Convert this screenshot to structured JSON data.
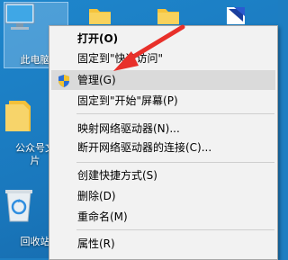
{
  "desktop": {
    "icons": [
      {
        "label_lines": [
          "此电脑"
        ]
      },
      {
        "label_lines": [
          "公众号文",
          "片"
        ]
      },
      {
        "label_lines": [
          "回收站"
        ]
      }
    ]
  },
  "context_menu": {
    "items": [
      {
        "label": "打开(O)"
      },
      {
        "label": "固定到\"快速访问\""
      },
      {
        "label": "管理(G)",
        "icon": "uac-shield-icon"
      },
      {
        "label": "固定到\"开始\"屏幕(P)"
      },
      {
        "label": "映射网络驱动器(N)..."
      },
      {
        "label": "断开网络驱动器的连接(C)..."
      },
      {
        "label": "创建快捷方式(S)"
      },
      {
        "label": "删除(D)"
      },
      {
        "label": "重命名(M)"
      },
      {
        "label": "属性(R)"
      }
    ]
  },
  "colors": {
    "desktop_bg": "#1a78bd",
    "menu_bg": "#f2f2f2",
    "highlight": "#dadada",
    "arrow": "#e8302a",
    "folder": "#f5c33b"
  }
}
